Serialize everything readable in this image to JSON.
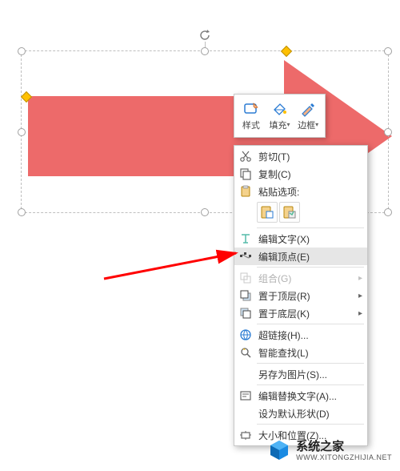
{
  "mini_toolbar": {
    "style_label": "样式",
    "fill_label": "填充",
    "outline_label": "边框"
  },
  "context_menu": {
    "cut": "剪切(T)",
    "copy": "复制(C)",
    "paste_section": "粘贴选项:",
    "edit_text": "编辑文字(X)",
    "edit_points": "编辑顶点(E)",
    "group": "组合(G)",
    "bring_front": "置于顶层(R)",
    "send_back": "置于底层(K)",
    "hyperlink": "超链接(H)...",
    "smart_lookup": "智能查找(L)",
    "save_as_picture": "另存为图片(S)...",
    "edit_alt_text": "编辑替换文字(A)...",
    "set_default_shape": "设为默认形状(D)",
    "size_position": "大小和位置(Z)..."
  },
  "watermark": {
    "title": "系统之家",
    "url": "WWW.XITONGZHIJIA.NET"
  }
}
